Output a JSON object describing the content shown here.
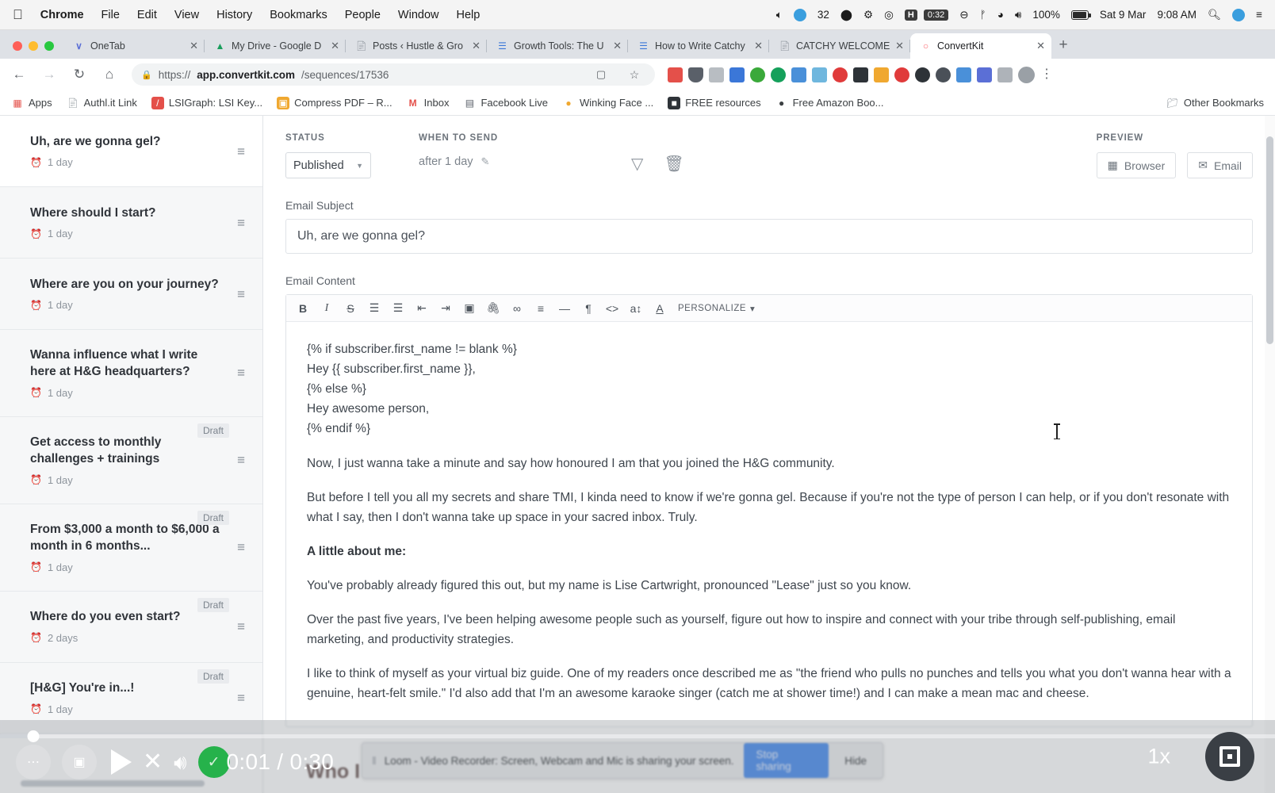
{
  "os_menubar": {
    "apple": "apple-logo",
    "items": [
      {
        "label": "Chrome",
        "bold": true
      },
      {
        "label": "File",
        "bold": false
      },
      {
        "label": "Edit",
        "bold": false
      },
      {
        "label": "View",
        "bold": false
      },
      {
        "label": "History",
        "bold": false
      },
      {
        "label": "Bookmarks",
        "bold": false
      },
      {
        "label": "People",
        "bold": false
      },
      {
        "label": "Window",
        "bold": false
      },
      {
        "label": "Help",
        "bold": false
      }
    ],
    "status": {
      "mic_icon": "microphone-icon",
      "dropbox_count": "32",
      "timer_label": "H",
      "timer_value": "0:32",
      "battery_percent": "100%",
      "date": "Sat 9 Mar",
      "time": "9:08 AM",
      "search_icon": "spotlight-search-icon",
      "siri_icon": "siri-icon",
      "control_center_icon": "notification-center-icon"
    }
  },
  "browser": {
    "tabs": [
      {
        "title": "OneTab",
        "favicon": "onetab-icon",
        "color": "#5b6fd6",
        "active": false
      },
      {
        "title": "My Drive - Google D",
        "favicon": "google-drive-icon",
        "color": "#1a9e5c",
        "active": false
      },
      {
        "title": "Posts ‹ Hustle & Gro",
        "favicon": "document-icon",
        "color": "#8d949c",
        "active": false
      },
      {
        "title": "Growth Tools: The U",
        "favicon": "blue-doc-icon",
        "color": "#3b77d8",
        "active": false
      },
      {
        "title": "How to Write Catchy",
        "favicon": "blue-doc-icon",
        "color": "#3b77d8",
        "active": false
      },
      {
        "title": "CATCHY WELCOME",
        "favicon": "document-icon",
        "color": "#8d949c",
        "active": false
      },
      {
        "title": "ConvertKit",
        "favicon": "convertkit-icon",
        "color": "#fb6970",
        "active": true
      }
    ],
    "tab_close_label": "✕",
    "new_tab_label": "+",
    "nav": {
      "back": "◀",
      "forward": "▶",
      "reload": "⟳",
      "home": "⌂"
    },
    "address": {
      "lock_icon": "lock-icon",
      "scheme": "https://",
      "host": "app.convertkit.com",
      "path": "/sequences/17536",
      "cast_icon": "cast-icon",
      "star_icon": "bookmark-star-icon"
    },
    "extensions": [
      {
        "name": "calendar-extension",
        "color": "#e4504a"
      },
      {
        "name": "shield-extension",
        "color": "#5a6069"
      },
      {
        "name": "clipboard-extension",
        "color": "#b8bdc2"
      },
      {
        "name": "code-extension",
        "color": "#3b77d8"
      },
      {
        "name": "evernote-extension",
        "color": "#3aa93a"
      },
      {
        "name": "grammarly-extension",
        "color": "#15a05b"
      },
      {
        "name": "eyedropper-extension",
        "color": "#4a90d9"
      },
      {
        "name": "firstaid-extension",
        "color": "#6fb7de"
      },
      {
        "name": "todoist-extension",
        "color": "#e03b3b"
      },
      {
        "name": "buffer-extension",
        "color": "#2e3338"
      },
      {
        "name": "honey-extension",
        "color": "#f0a830"
      },
      {
        "name": "hotjar-extension",
        "color": "#e03b3b"
      },
      {
        "name": "avatar-extension",
        "color": "#2e3338"
      },
      {
        "name": "moon-extension",
        "color": "#4a5058"
      },
      {
        "name": "feather-extension",
        "color": "#4a90d9"
      },
      {
        "name": "onetab-extension",
        "color": "#5b6fd6"
      },
      {
        "name": "grey-extension",
        "color": "#aeb3b9"
      }
    ],
    "profile_icon": "profile-avatar",
    "menu_icon": "chrome-menu-icon",
    "bookmarks": [
      {
        "label": "Apps",
        "icon": "apps-grid-icon",
        "color": "#e4504a"
      },
      {
        "label": "Authl.it Link",
        "icon": "page-icon",
        "color": "#9aa0a6"
      },
      {
        "label": "LSIGraph: LSI Key...",
        "icon": "lsigraph-icon",
        "color": "#e4504a"
      },
      {
        "label": "Compress PDF – R...",
        "icon": "compress-pdf-icon",
        "color": "#f0a830"
      },
      {
        "label": "Inbox",
        "icon": "gmail-icon",
        "color": "#e4504a"
      },
      {
        "label": "Facebook Live",
        "icon": "facebook-live-icon",
        "color": "#5a6069"
      },
      {
        "label": "Winking Face ...",
        "icon": "winking-face-icon",
        "color": "#f0a830"
      },
      {
        "label": "FREE resources",
        "icon": "free-resources-icon",
        "color": "#2e3338"
      },
      {
        "label": "Free Amazon Boo...",
        "icon": "amazon-book-icon",
        "color": "#3c4043"
      }
    ],
    "other_bookmarks": {
      "label": "Other Bookmarks",
      "icon": "folder-icon"
    }
  },
  "sidebar": {
    "sequence_emails": [
      {
        "title": "Uh, are we gonna gel?",
        "delay": "1 day",
        "status": "",
        "current": true
      },
      {
        "title": "Where should I start?",
        "delay": "1 day",
        "status": "",
        "current": false
      },
      {
        "title": "Where are you on your journey?",
        "delay": "1 day",
        "status": "",
        "current": false
      },
      {
        "title": "Wanna influence what I write here at H&G headquarters?",
        "delay": "1 day",
        "status": "",
        "current": false
      },
      {
        "title": "Get access to monthly challenges + trainings",
        "delay": "1 day",
        "status": "Draft",
        "current": false
      },
      {
        "title": "From $3,000 a month to $6,000 a month in 6 months...",
        "delay": "1 day",
        "status": "Draft",
        "current": false
      },
      {
        "title": "Where do you even start?",
        "delay": "2 days",
        "status": "Draft",
        "current": false
      },
      {
        "title": "[H&G] You're in...!",
        "delay": "1 day",
        "status": "Draft",
        "current": false
      }
    ],
    "drag_handle_icon": "drag-handle-icon",
    "clock_icon": "alarm-clock-icon"
  },
  "main": {
    "status_label": "STATUS",
    "status_value": "Published",
    "when_label": "WHEN TO SEND",
    "when_value": "after 1 day",
    "edit_icon": "pencil-edit-icon",
    "filter_icon": "filter-funnel-icon",
    "delete_icon": "trash-delete-icon",
    "preview_label": "PREVIEW",
    "preview_browser": "Browser",
    "preview_email": "Email",
    "subject_label": "Email Subject",
    "subject_value": "Uh, are we gonna gel?",
    "content_label": "Email Content",
    "toolbar": [
      {
        "name": "bold-button",
        "glyph": "B",
        "cls": "bold"
      },
      {
        "name": "italic-button",
        "glyph": "I",
        "cls": "ital"
      },
      {
        "name": "strikethrough-button",
        "glyph": "S",
        "cls": "strike"
      },
      {
        "name": "numbered-list-button",
        "glyph": "☰",
        "cls": ""
      },
      {
        "name": "bulleted-list-button",
        "glyph": "☰",
        "cls": ""
      },
      {
        "name": "outdent-button",
        "glyph": "⇤",
        "cls": ""
      },
      {
        "name": "indent-button",
        "glyph": "⇥",
        "cls": ""
      },
      {
        "name": "image-button",
        "glyph": "▣",
        "cls": ""
      },
      {
        "name": "attachment-button",
        "glyph": "🖇",
        "cls": ""
      },
      {
        "name": "link-button",
        "glyph": "∞",
        "cls": ""
      },
      {
        "name": "align-button",
        "glyph": "≡",
        "cls": ""
      },
      {
        "name": "horizontal-rule-button",
        "glyph": "—",
        "cls": ""
      },
      {
        "name": "paragraph-button",
        "glyph": "¶",
        "cls": ""
      },
      {
        "name": "code-button",
        "glyph": "<>",
        "cls": ""
      },
      {
        "name": "text-size-button",
        "glyph": "a↕",
        "cls": ""
      },
      {
        "name": "text-color-button",
        "glyph": "A",
        "cls": ""
      }
    ],
    "personalize_label": "PERSONALIZE",
    "personalize_caret": "▾",
    "body": {
      "liquid_lines": [
        "{% if subscriber.first_name != blank %}",
        "Hey {{ subscriber.first_name }},",
        "{% else %}",
        "Hey awesome person,",
        "{% endif %}"
      ],
      "paragraphs": [
        "Now, I just wanna take a minute and say how honoured I am that you joined the H&G community.",
        "But before I tell you all my secrets and share TMI, I kinda need to know if we're gonna gel. Because if you're not the type of person I can help, or if you don't resonate with what I say, then I don't wanna take up space in your sacred inbox. Truly."
      ],
      "heading": "A little about me:",
      "paragraphs2": [
        "You've probably already figured this out, but my name is Lise Cartwright, pronounced \"Lease\" just so you know.",
        "Over the past five years, I've been helping awesome people such as yourself, figure out how to inspire and connect with your tribe through self-publishing, email marketing, and productivity strategies.",
        "I like to think of myself as your virtual biz guide. One of my readers once described me as \"the friend who pulls no punches and tells you what you don't wanna hear with a genuine, heart-felt smile.\" I'd also add that I'm an awesome karaoke singer (catch me at shower time!) and I can make a mean mac and cheese."
      ],
      "partial_heading": "Who I C"
    }
  },
  "sharebar": {
    "message": "Loom - Video Recorder: Screen, Webcam and Mic is sharing your screen.",
    "stop_label": "Stop sharing",
    "hide_label": "Hide",
    "grip_icon": "drag-grip-icon"
  },
  "videobar": {
    "more_icon": "more-options-icon",
    "pip_icon": "picture-in-picture-icon",
    "play_icon": "play-button-icon",
    "close_icon": "close-video-icon",
    "volume_icon": "volume-icon",
    "check_icon": "check-mark-icon",
    "time_current": "0:01",
    "time_separator": "/",
    "time_total": "0:30",
    "time_display": "0:01 / 0:30",
    "speed": "1x",
    "fullscreen_icon": "fullscreen-icon"
  },
  "colors": {
    "accent_blue": "#4a8df0",
    "green": "#26b24b",
    "chrome_tabbar": "#dee1e6",
    "convertkit_red": "#fb6970"
  }
}
